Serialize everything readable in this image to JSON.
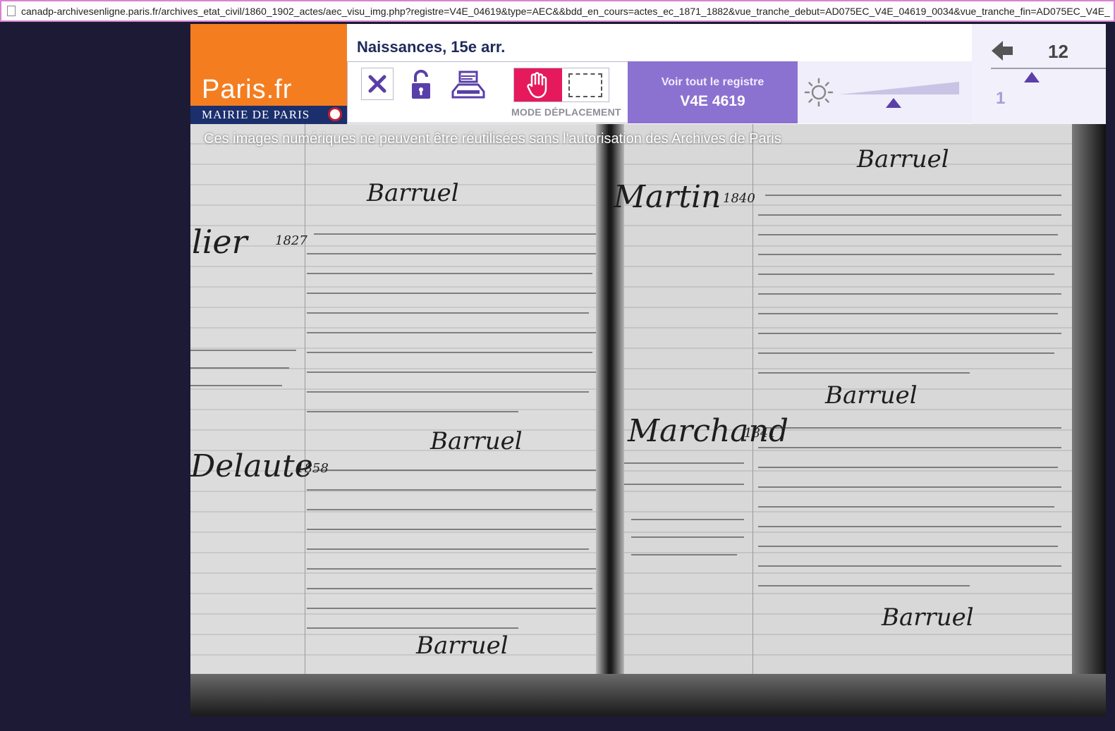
{
  "browser": {
    "url": "canadp-archivesenligne.paris.fr/archives_etat_civil/1860_1902_actes/aec_visu_img.php?registre=V4E_04619&type=AEC&&bdd_en_cours=actes_ec_1871_1882&vue_tranche_debut=AD075EC_V4E_04619_0034&vue_tranche_fin=AD075EC_V4E_"
  },
  "logo": {
    "brand": "Paris.fr",
    "subtitle": "MAIRIE DE PARIS"
  },
  "toolbar": {
    "title": "Naissances, 15e arr.",
    "close_icon": "close-icon",
    "mode_label": "MODE DÉPLACEMENT",
    "register_line1": "Voir tout le registre",
    "register_line2": "V4E 4619",
    "accent": "#8c72d0",
    "active_mode_color": "#e6195c"
  },
  "brightness": {
    "icon": "sun-icon"
  },
  "navigation": {
    "current_page": "12",
    "min_page": "1"
  },
  "viewer": {
    "watermark": "Ces images numériques ne peuvent être réutilisées sans l'autorisation des Archives de Paris",
    "left_names": [
      "lier",
      "Delaute"
    ],
    "left_years": [
      "1827",
      "1858"
    ],
    "right_names": [
      "Martin",
      "Marchand"
    ],
    "right_years": [
      "1840",
      "1841"
    ],
    "signature": "Barruel"
  }
}
